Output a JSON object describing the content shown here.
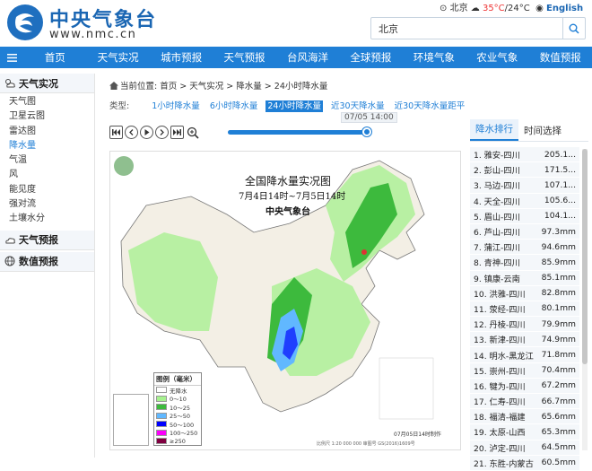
{
  "header": {
    "brand_cn": "中央气象台",
    "brand_en": "www.nmc.cn",
    "location": "北京",
    "temp_high": "35°C",
    "temp_sep": "/",
    "temp_low": "24°C",
    "lang": "English",
    "search_value": "北京"
  },
  "nav": {
    "items": [
      "首页",
      "天气实况",
      "城市预报",
      "天气预报",
      "台风海洋",
      "全球预报",
      "环境气象",
      "农业气象",
      "数值预报"
    ]
  },
  "sidebar": {
    "section1": "天气实况",
    "items": [
      "天气图",
      "卫星云图",
      "雷达图",
      "降水量",
      "气温",
      "风",
      "能见度",
      "强对流",
      "土壤水分"
    ],
    "section2": "天气预报",
    "section3": "数值预报"
  },
  "breadcrumb": {
    "prefix": "当前位置:",
    "parts": [
      "首页",
      "天气实况",
      "降水量",
      "24小时降水量"
    ]
  },
  "types": {
    "label": "类型:",
    "options": [
      "1小时降水量",
      "6小时降水量",
      "24小时降水量",
      "近30天降水量",
      "近30天降水量距平"
    ],
    "selected_index": 2
  },
  "player": {
    "time": "07/05 14:00",
    "progress": 1.0
  },
  "map": {
    "title": "全国降水量实况图",
    "subtitle": "7月4日14时~7月5日14时",
    "org": "中央气象台",
    "legend_title": "图例（毫米）",
    "legend": [
      {
        "label": "无降水",
        "color": "#ffffff"
      },
      {
        "label": "0～10",
        "color": "#a6f28f"
      },
      {
        "label": "10～25",
        "color": "#3dba3d"
      },
      {
        "label": "25～50",
        "color": "#61b8ff"
      },
      {
        "label": "50～100",
        "color": "#0000fe"
      },
      {
        "label": "100～250",
        "color": "#fa00fa"
      },
      {
        "label": "≥250",
        "color": "#800040"
      }
    ],
    "footer1": "07月05日14时制作",
    "footer2": "比例尺 1:20 000 000    审图号 GS(2016)1609号"
  },
  "rank": {
    "tabs": [
      "降水排行",
      "时间选择"
    ],
    "rows": [
      {
        "name": "1. 雅安-四川",
        "value": "205.1..."
      },
      {
        "name": "2. 彭山-四川",
        "value": "171.5..."
      },
      {
        "name": "3. 马边-四川",
        "value": "107.1..."
      },
      {
        "name": "4. 天全-四川",
        "value": "105.6..."
      },
      {
        "name": "5. 眉山-四川",
        "value": "104.1..."
      },
      {
        "name": "6. 芦山-四川",
        "value": "97.3mm"
      },
      {
        "name": "7. 蒲江-四川",
        "value": "94.6mm"
      },
      {
        "name": "8. 青神-四川",
        "value": "85.9mm"
      },
      {
        "name": "9. 镇康-云南",
        "value": "85.1mm"
      },
      {
        "name": "10. 洪雅-四川",
        "value": "82.8mm"
      },
      {
        "name": "11. 荥经-四川",
        "value": "80.1mm"
      },
      {
        "name": "12. 丹棱-四川",
        "value": "79.9mm"
      },
      {
        "name": "13. 新津-四川",
        "value": "74.9mm"
      },
      {
        "name": "14. 明水-黑龙江",
        "value": "71.8mm"
      },
      {
        "name": "15. 崇州-四川",
        "value": "70.4mm"
      },
      {
        "name": "16. 犍为-四川",
        "value": "67.2mm"
      },
      {
        "name": "17. 仁寿-四川",
        "value": "66.7mm"
      },
      {
        "name": "18. 福清-福建",
        "value": "65.6mm"
      },
      {
        "name": "19. 太原-山西",
        "value": "65.3mm"
      },
      {
        "name": "20. 泸定-四川",
        "value": "64.5mm"
      },
      {
        "name": "21. 东胜-内蒙古",
        "value": "60.5mm"
      }
    ]
  }
}
